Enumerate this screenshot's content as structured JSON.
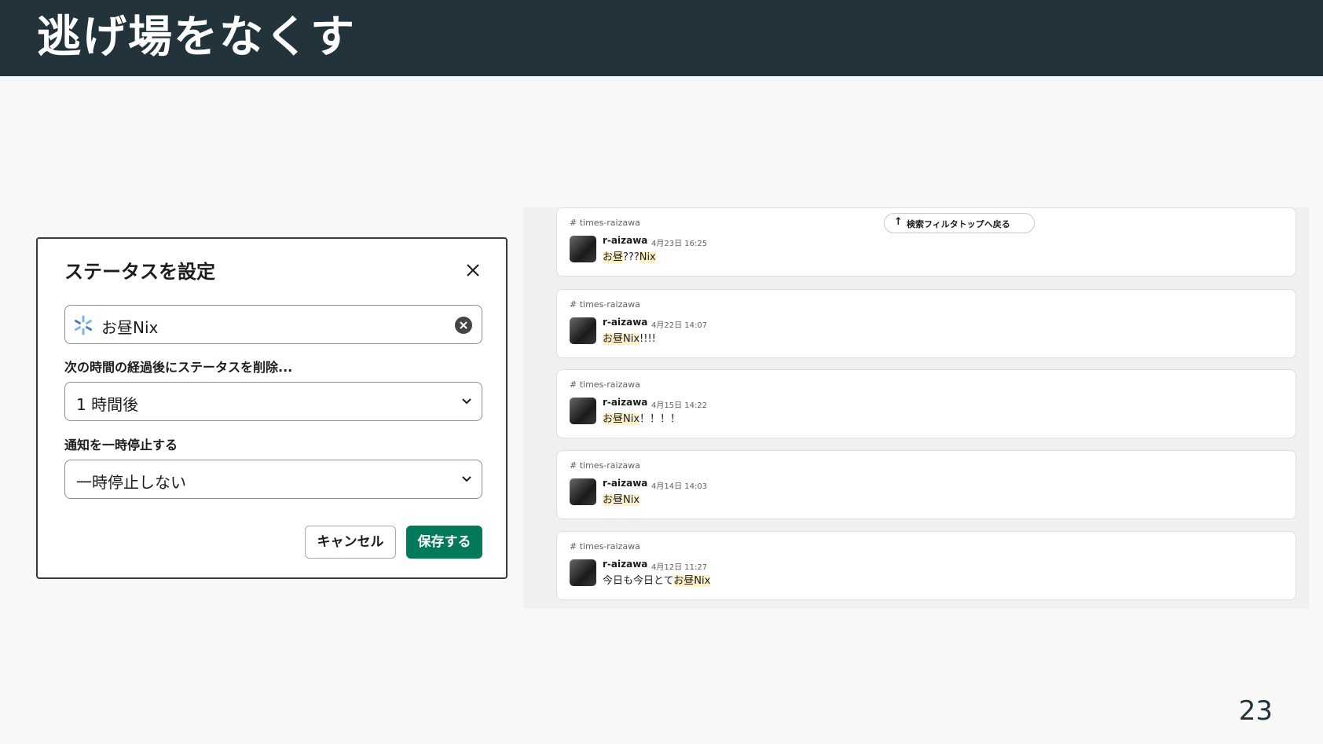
{
  "slide": {
    "title": "逃げ場をなくす",
    "page_number": "23"
  },
  "status_dialog": {
    "title": "ステータスを設定",
    "status_value": "お昼Nix",
    "status_emoji_icon": "nix-snowflake-icon",
    "clear_after_label": "次の時間の経過後にステータスを削除...",
    "clear_after_value": "1 時間後",
    "pause_label": "通知を一時停止する",
    "pause_value": "一時停止しない",
    "cancel_label": "キャンセル",
    "save_label": "保存する",
    "colors": {
      "save": "#007a5a",
      "clear_icon": "#454545"
    }
  },
  "search_results": {
    "back_button": "検索フィルタトップへ戻る",
    "results": [
      {
        "channel": "times-raizawa",
        "author": "r-aizawa",
        "time": "4月23日 16:25",
        "pre": "",
        "highlight": "お昼",
        "mid": "???",
        "highlight2": "Nix",
        "post": ""
      },
      {
        "channel": "times-raizawa",
        "author": "r-aizawa",
        "time": "4月22日 14:07",
        "pre": "",
        "highlight": "お昼",
        "mid": "",
        "highlight2": "Nix",
        "post": "!!!!"
      },
      {
        "channel": "times-raizawa",
        "author": "r-aizawa",
        "time": "4月15日 14:22",
        "pre": "",
        "highlight": "お昼",
        "mid": "",
        "highlight2": "Nix",
        "post": "！！！！"
      },
      {
        "channel": "times-raizawa",
        "author": "r-aizawa",
        "time": "4月14日 14:03",
        "pre": "",
        "highlight": "お昼",
        "mid": "",
        "highlight2": "Nix",
        "post": ""
      },
      {
        "channel": "times-raizawa",
        "author": "r-aizawa",
        "time": "4月12日 11:27",
        "pre": "今日も今日とて",
        "highlight": "お昼",
        "mid": "",
        "highlight2": "Nix",
        "post": ""
      }
    ]
  }
}
